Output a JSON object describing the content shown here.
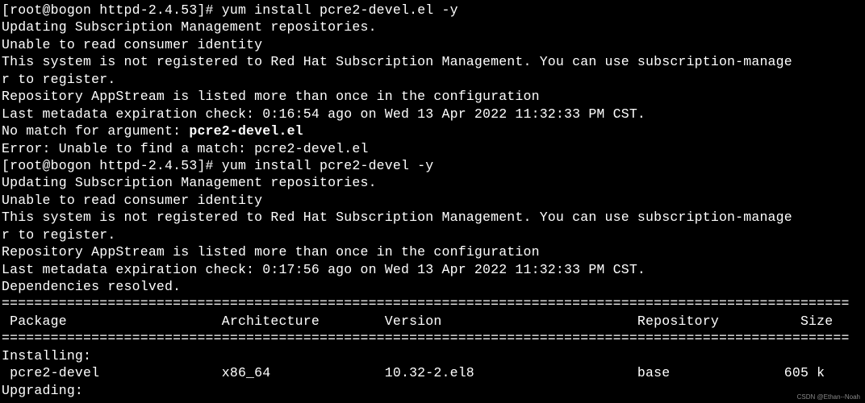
{
  "prompt1": {
    "prefix": "[root@bogon httpd-2.4.53]# ",
    "command": "yum install pcre2-devel.el -y"
  },
  "out1": {
    "l1": "Updating Subscription Management repositories.",
    "l2": "Unable to read consumer identity",
    "l3": "This system is not registered to Red Hat Subscription Management. You can use subscription-manage",
    "l4": "r to register.",
    "l5": "Repository AppStream is listed more than once in the configuration",
    "l6": "Last metadata expiration check: 0:16:54 ago on Wed 13 Apr 2022 11:32:33 PM CST.",
    "l7a": "No match for argument: ",
    "l7b": "pcre2-devel.el",
    "l8": "Error: Unable to find a match: pcre2-devel.el"
  },
  "prompt2": {
    "prefix": "[root@bogon httpd-2.4.53]# ",
    "command": "yum install pcre2-devel -y"
  },
  "out2": {
    "l1": "Updating Subscription Management repositories.",
    "l2": "Unable to read consumer identity",
    "l3": "This system is not registered to Red Hat Subscription Management. You can use subscription-manage",
    "l4": "r to register.",
    "l5": "Repository AppStream is listed more than once in the configuration",
    "l6": "Last metadata expiration check: 0:17:56 ago on Wed 13 Apr 2022 11:32:33 PM CST.",
    "l7": "Dependencies resolved."
  },
  "divider": "========================================================================================================",
  "header": " Package                   Architecture        Version                        Repository          Size",
  "installing": "Installing:",
  "row": " pcre2-devel               x86_64              10.32-2.el8                    base              605 k",
  "upgrading": "Upgrading:",
  "watermark": "CSDN @Ethan--Noah"
}
